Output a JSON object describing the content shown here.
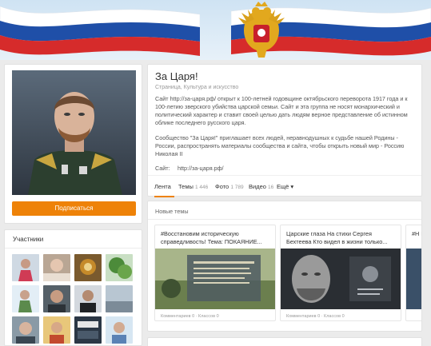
{
  "group": {
    "name": "За Царя!",
    "category": "Страница, Культура и искусство",
    "description": "Сайт http://за-царя.рф/ открыт к 100-летней годовщине октябрьского переворота 1917 года и к 100-летию зверского убийства царской семьи. Сайт и эта группа не носят монархический и политический характер и ставит своей целью дать людям верное представление об истинном облике последнего русского царя.",
    "invitation": "Сообщество \"За Царя!\" приглашает всех людей, неравнодушных к судьбе нашей Родины - России, распространять материалы сообщества и сайта, чтобы открыть новый мир - Россию Николая II",
    "site_label": "Сайт:",
    "site_url": "http://за-царя.рф/",
    "subscribe_label": "Подписаться"
  },
  "tabs": [
    {
      "label": "Лента",
      "count": ""
    },
    {
      "label": "Темы",
      "count": "1 446"
    },
    {
      "label": "Фото",
      "count": "1 789"
    },
    {
      "label": "Видео",
      "count": "16"
    },
    {
      "label": "Ещё ▾",
      "count": ""
    }
  ],
  "members": {
    "title": "Участники"
  },
  "new_topics": {
    "title": "Новые темы",
    "items": [
      {
        "title": "#Восстановим историческую справедливость! Тема: ПОКАЯНИЕ...",
        "meta": "Комментариев 0  ·  Классов 0"
      },
      {
        "title": "Царские глаза На стихи Сергея Бехтеева Кто видел в жизни только...",
        "meta": "Комментариев 0  ·  Классов 0"
      },
      {
        "title": "#Н П",
        "meta": ""
      }
    ]
  },
  "colors": {
    "accent": "#ee8208",
    "link": "#555555"
  }
}
